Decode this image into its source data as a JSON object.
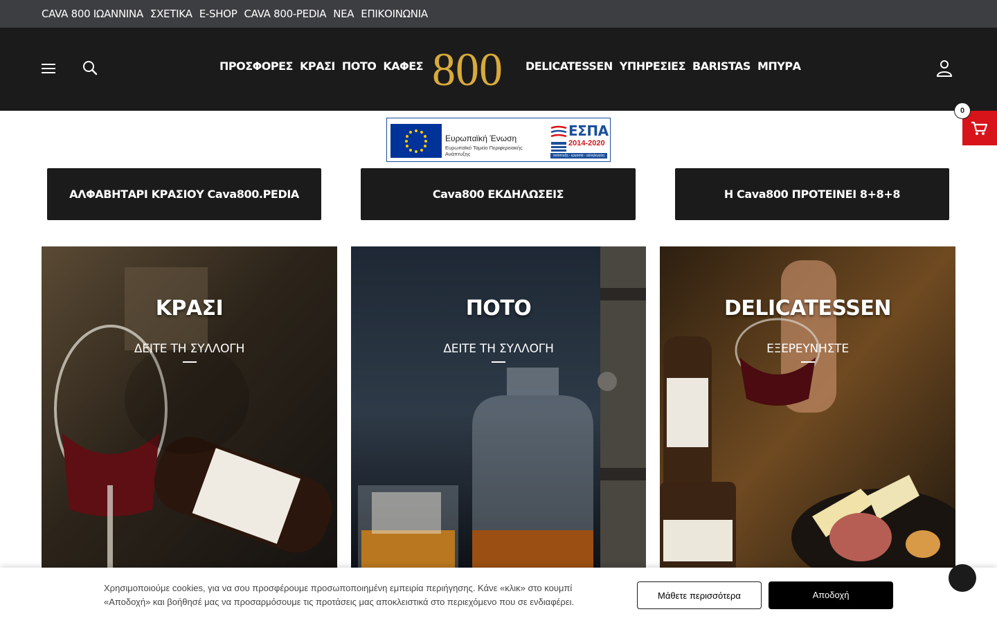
{
  "topbar": {
    "links": [
      "CAVA 800 ΙΩΑΝΝΙΝΑ",
      "ΣΧΕΤΙΚΑ",
      "E-SHOP",
      "CAVA 800-PEDIA",
      "ΝΕΑ",
      "ΕΠΙΚΟΙΝΩΝΙΑ"
    ]
  },
  "header": {
    "nav_left": [
      "ΠΡΟΣΦΟΡΕΣ",
      "ΚΡΑΣΙ",
      "ΠΟΤΟ",
      "ΚΑΦΕΣ"
    ],
    "logo": "800",
    "nav_right": [
      "DELICATESSEN",
      "ΥΠΗΡΕΣΙΕΣ",
      "BARISTAS",
      "ΜΠΥΡΑ"
    ],
    "cart_count": "0",
    "colors": {
      "bar": "#3d3e41",
      "header": "#1c1b1b",
      "logo": "#d7aa3b",
      "cart": "#d7141a"
    },
    "icons": [
      "menu-icon",
      "search-icon",
      "account-icon",
      "cart-icon"
    ]
  },
  "espa": {
    "eu_label": "Ευρωπαϊκή Ένωση",
    "eu_fund": "Ευρωπαϊκό Ταμείο Περιφερειακής Ανάπτυξης",
    "title": "ΕΣΠΑ",
    "years": "2014-2020",
    "slogan": "ανάπτυξη - εργασία - αλληλεγγύη"
  },
  "featured_buttons": [
    "ΑΛΦΑΒΗΤΑΡΙ ΚΡΑΣΙΟΥ Cava800.PEDIA",
    "Cava800 ΕΚΔΗΛΩΣΕΙΣ",
    "Η Cava800 ΠΡΟΤΕΙΝΕΙ 8+8+8"
  ],
  "categories": [
    {
      "title": "ΚΡΑΣΙ",
      "link": "ΔΕΙΤΕ ΤΗ ΣΥΛΛΟΓΗ"
    },
    {
      "title": "ΠΟΤΟ",
      "link": "ΔΕΙΤΕ ΤΗ ΣΥΛΛΟΓΗ"
    },
    {
      "title": "DELICATESSEN",
      "link": "ΕΞΕΡΕΥΝΗΣΤΕ"
    }
  ],
  "cookie": {
    "text": "Χρησιμοποιούμε cookies, για να σου προσφέρουμε προσωποποιημένη εμπειρία περιήγησης. Κάνε «κλικ» στο κουμπί «Αποδοχή» και βοήθησέ μας να προσαρμόσουμε τις προτάσεις μας αποκλειστικά στο περιεχόμενο που σε ενδιαφέρει.",
    "learn_more": "Μάθετε περισσότερα",
    "accept": "Αποδοχή"
  }
}
